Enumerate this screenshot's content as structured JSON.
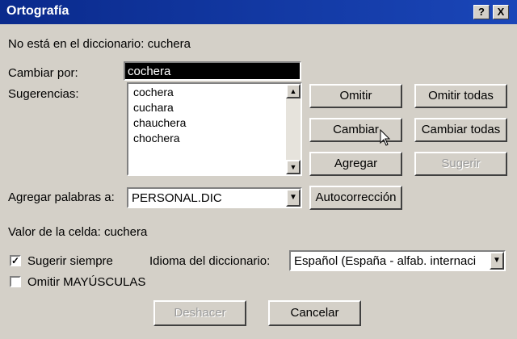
{
  "window": {
    "title": "Ortografía",
    "help_button": "?",
    "close_button": "X"
  },
  "not_in_dictionary_label": "No está en el diccionario: cuchera",
  "change_to": {
    "label": "Cambiar por:",
    "value": "cochera"
  },
  "suggestions": {
    "label": "Sugerencias:",
    "items": [
      "cochera",
      "cuchara",
      "chauchera",
      "chochera"
    ]
  },
  "add_words": {
    "label": "Agregar palabras a:",
    "value": "PERSONAL.DIC"
  },
  "cell_value_label": "Valor de la celda: cuchera",
  "always_suggest": {
    "label": "Sugerir siempre",
    "checked": true
  },
  "ignore_uppercase": {
    "label": "Omitir MAYÚSCULAS",
    "checked": false
  },
  "dictionary_language": {
    "label": "Idioma del diccionario:",
    "value": "Español (España - alfab. internaci"
  },
  "buttons": {
    "ignore": "Omitir",
    "ignore_all": "Omitir todas",
    "change": "Cambiar",
    "change_all": "Cambiar todas",
    "add": "Agregar",
    "suggest": "Sugerir",
    "autocorrect": "Autocorrección",
    "undo": "Deshacer",
    "cancel": "Cancelar"
  }
}
